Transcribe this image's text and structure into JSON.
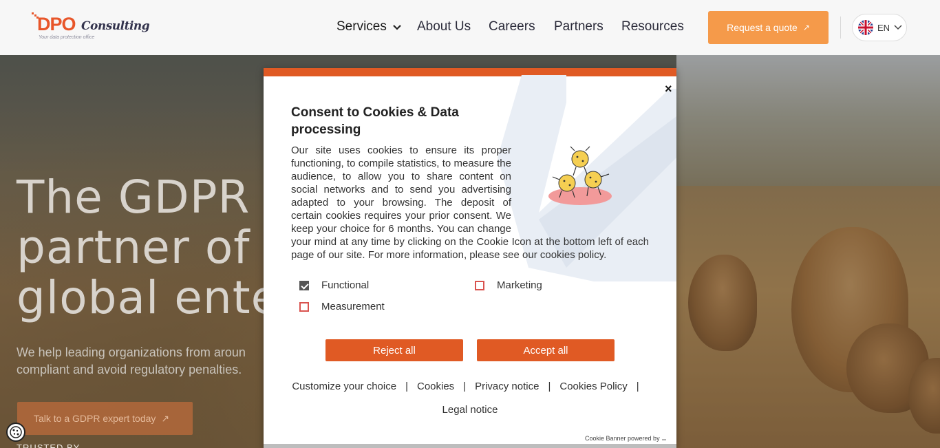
{
  "header": {
    "logo": {
      "brand_main": "DPO",
      "brand_second": "Consulting",
      "tagline": "Your data protection office"
    },
    "nav": {
      "services": "Services",
      "about": "About Us",
      "careers": "Careers",
      "partners": "Partners",
      "resources": "Resources"
    },
    "quote_button": "Request a quote",
    "quote_arrow": "↗",
    "language": "EN"
  },
  "hero": {
    "title": "The GDPR co\npartner of cl\nglobal enterp",
    "subtitle": "We help leading organizations from aroun\ncompliant and avoid regulatory penalties.",
    "cta": "Talk to a GDPR expert today",
    "cta_arrow": "↗",
    "trusted": "TRUSTED BY"
  },
  "cookie_modal": {
    "close": "×",
    "title": "Consent to Cookies & Data processing",
    "body": "Our site uses cookies to ensure its proper functioning, to compile statistics, to measure the audience, to allow you to share content on social networks and to send you advertising adapted to your browsing. The deposit of certain cookies requires your prior consent. We keep your choice for 6 months. You can change your mind at any time by clicking on the Cookie Icon at the bottom left of each page of our site. For more information, please see our cookies policy.",
    "options": {
      "functional": {
        "label": "Functional",
        "checked": true
      },
      "marketing": {
        "label": "Marketing",
        "checked": false
      },
      "measurement": {
        "label": "Measurement",
        "checked": false
      }
    },
    "reject_all": "Reject all",
    "accept_all": "Accept all",
    "links": {
      "customize": "Customize your choice",
      "cookies": "Cookies",
      "privacy": "Privacy notice",
      "cookies_policy": "Cookies Policy",
      "legal": "Legal notice",
      "separator": "|"
    },
    "powered_by": "Cookie Banner powered by"
  },
  "colors": {
    "accent_orange": "#e05a24",
    "quote_button": "#f59a4a"
  }
}
